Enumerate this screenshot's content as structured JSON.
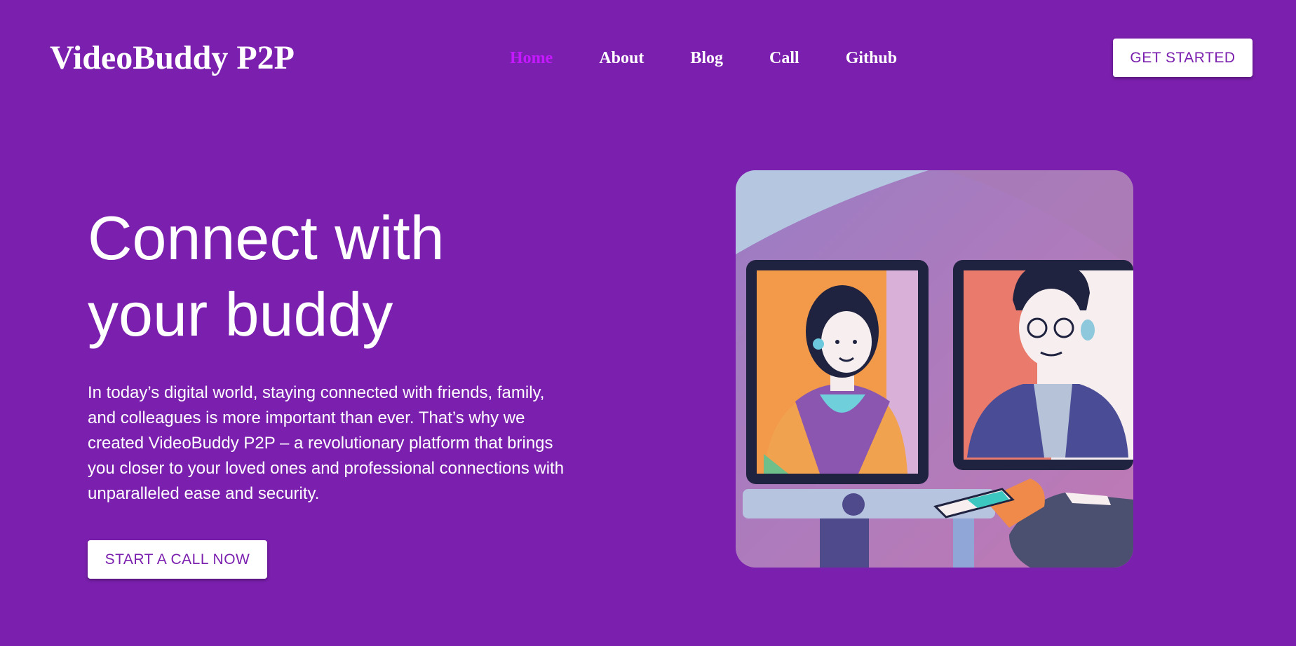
{
  "theme": {
    "background": "#7b1fae",
    "active_link": "#c418ff",
    "button_bg": "#ffffff",
    "button_text": "#7b1fae"
  },
  "header": {
    "brand": "VideoBuddy P2P",
    "nav": [
      {
        "label": "Home",
        "active": true
      },
      {
        "label": "About",
        "active": false
      },
      {
        "label": "Blog",
        "active": false
      },
      {
        "label": "Call",
        "active": false
      },
      {
        "label": "Github",
        "active": false
      }
    ],
    "cta_label": "GET STARTED"
  },
  "hero": {
    "title_line1": "Connect with",
    "title_line2": "your buddy",
    "description": "In today’s digital world, staying connected with friends, family, and colleagues is more important than ever. That’s why we created VideoBuddy P2P – a revolutionary platform that brings you closer to your loved ones and professional connections with unparalleled ease and security.",
    "cta_label": "START A CALL NOW",
    "illustration": "video-call-illustration"
  }
}
